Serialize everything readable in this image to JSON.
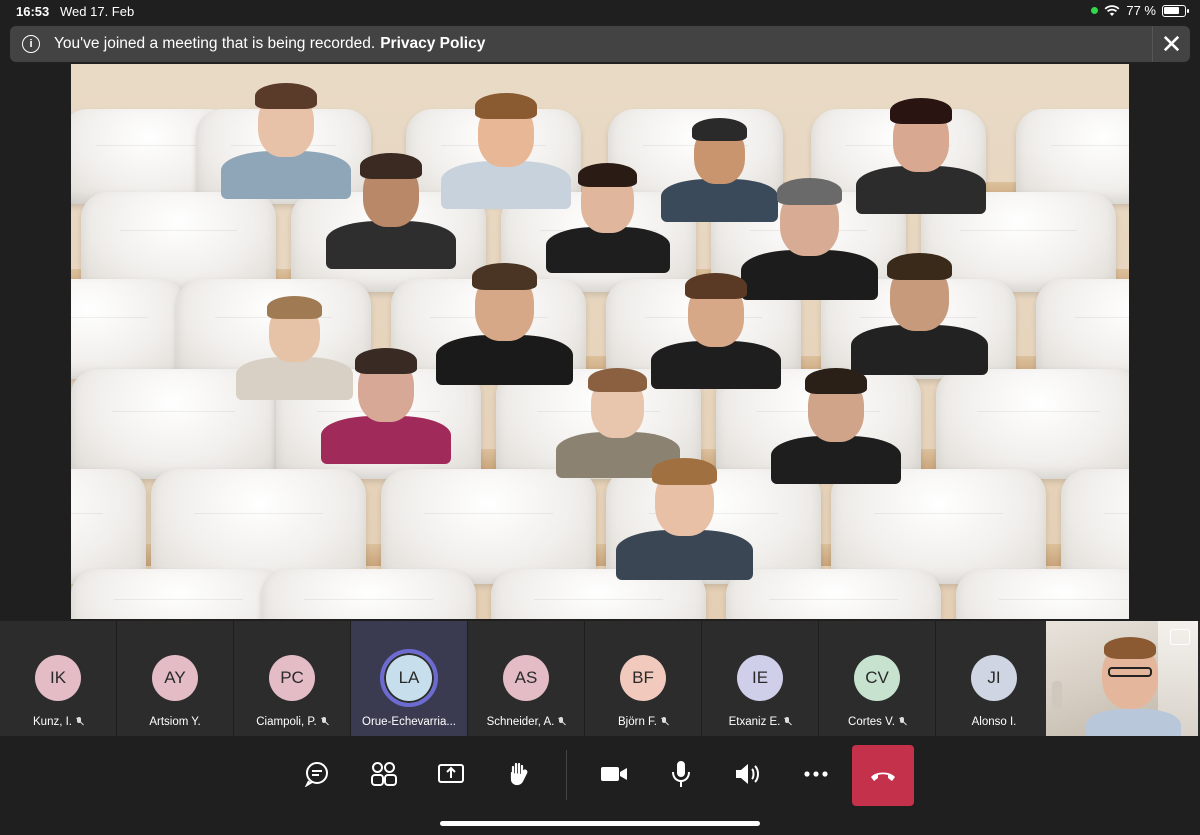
{
  "status_bar": {
    "time": "16:53",
    "date": "Wed 17. Feb",
    "battery_text": "77 %",
    "battery_level": 0.77
  },
  "banner": {
    "message": "You've joined a meeting that is being recorded.",
    "link": "Privacy Policy",
    "icon": "info-icon",
    "close_icon": "close-icon"
  },
  "participants": [
    {
      "initials": "IK",
      "name": "Kunz, I.",
      "muted": true,
      "color": "#e3bcc6"
    },
    {
      "initials": "AY",
      "name": "Artsiom Y.",
      "muted": false,
      "color": "#e3bcc6"
    },
    {
      "initials": "PC",
      "name": "Ciampoli, P.",
      "muted": true,
      "color": "#e3bcc6"
    },
    {
      "initials": "LA",
      "name": "Orue-Echevarria...",
      "muted": false,
      "color": "#c7dfec",
      "active": true
    },
    {
      "initials": "AS",
      "name": "Schneider, A.",
      "muted": true,
      "color": "#e3bcc6"
    },
    {
      "initials": "BF",
      "name": "Björn F.",
      "muted": true,
      "color": "#f1c9bd"
    },
    {
      "initials": "IE",
      "name": "Etxaniz E.",
      "muted": true,
      "color": "#d0cfea"
    },
    {
      "initials": "CV",
      "name": "Cortes V.",
      "muted": true,
      "color": "#c7e3cf"
    },
    {
      "initials": "JI",
      "name": "Alonso I.",
      "muted": false,
      "color": "#cfd5e2"
    }
  ],
  "controls": {
    "chat": "chat-icon",
    "people": "people-icon",
    "share": "share-screen-icon",
    "raise_hand": "raise-hand-icon",
    "camera": "camera-icon",
    "mic": "microphone-icon",
    "speaker": "speaker-icon",
    "more": "more-icon",
    "hangup": "hang-up-icon"
  },
  "colors": {
    "hangup": "#c4314b",
    "active_ring": "#6b6bd1",
    "recording_dot": "#32d74b"
  }
}
